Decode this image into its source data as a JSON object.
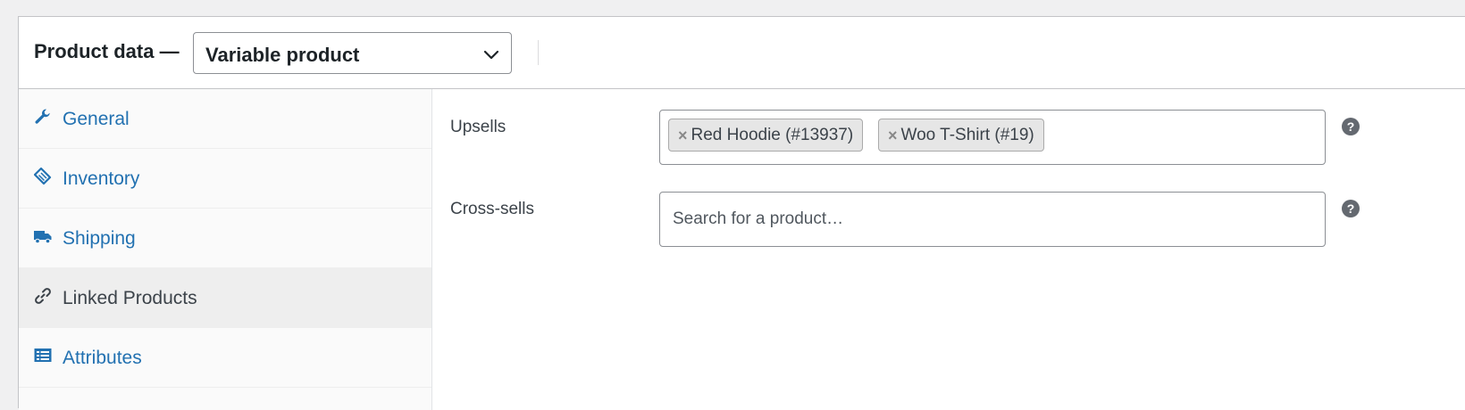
{
  "header": {
    "title": "Product data —",
    "product_type": {
      "selected": "Variable product",
      "icon": "chevron-down-icon"
    }
  },
  "sidebar": {
    "tabs": [
      {
        "label": "General",
        "icon": "wrench-icon",
        "active": false
      },
      {
        "label": "Inventory",
        "icon": "tag-icon",
        "active": false
      },
      {
        "label": "Shipping",
        "icon": "truck-icon",
        "active": false
      },
      {
        "label": "Linked Products",
        "icon": "link-icon",
        "active": true
      },
      {
        "label": "Attributes",
        "icon": "list-icon",
        "active": false
      }
    ]
  },
  "linked_products": {
    "upsells": {
      "label": "Upsells",
      "items": [
        {
          "name": "Red Hoodie (#13937)",
          "remove": "×"
        },
        {
          "name": "Woo T-Shirt (#19)",
          "remove": "×"
        }
      ],
      "help": "?"
    },
    "cross_sells": {
      "label": "Cross-sells",
      "placeholder": "Search for a product…",
      "help": "?"
    }
  },
  "colors": {
    "link": "#2271b1",
    "active_tab_bg": "#eeeeee",
    "border": "#8c8f94",
    "icon": "#2271b1"
  }
}
